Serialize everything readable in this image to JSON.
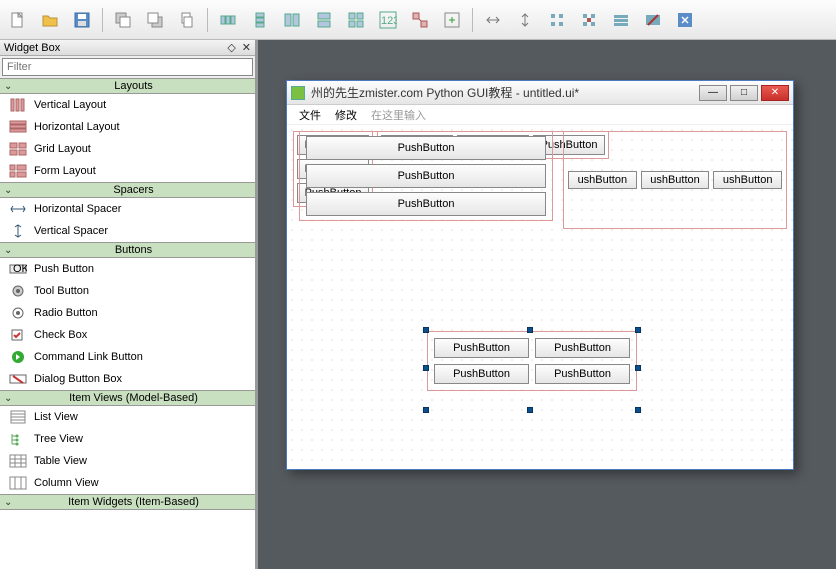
{
  "panel": {
    "title": "Widget Box",
    "filter_placeholder": "Filter"
  },
  "categories": [
    {
      "name": "Layouts",
      "items": [
        {
          "icon": "vlayout",
          "label": "Vertical Layout"
        },
        {
          "icon": "hlayout",
          "label": "Horizontal Layout"
        },
        {
          "icon": "grid",
          "label": "Grid Layout"
        },
        {
          "icon": "form",
          "label": "Form Layout"
        }
      ]
    },
    {
      "name": "Spacers",
      "items": [
        {
          "icon": "hspacer",
          "label": "Horizontal Spacer"
        },
        {
          "icon": "vspacer",
          "label": "Vertical Spacer"
        }
      ]
    },
    {
      "name": "Buttons",
      "items": [
        {
          "icon": "pushbtn",
          "label": "Push Button"
        },
        {
          "icon": "toolbtn",
          "label": "Tool Button"
        },
        {
          "icon": "radio",
          "label": "Radio Button"
        },
        {
          "icon": "check",
          "label": "Check Box"
        },
        {
          "icon": "cmdlink",
          "label": "Command Link Button"
        },
        {
          "icon": "dlgbox",
          "label": "Dialog Button Box"
        }
      ]
    },
    {
      "name": "Item Views (Model-Based)",
      "items": [
        {
          "icon": "list",
          "label": "List View"
        },
        {
          "icon": "treev",
          "label": "Tree View"
        },
        {
          "icon": "table",
          "label": "Table View"
        },
        {
          "icon": "column",
          "label": "Column View"
        }
      ]
    },
    {
      "name": "Item Widgets (Item-Based)",
      "items": []
    }
  ],
  "designed_window": {
    "title": "州的先生zmister.com Python GUI教程 - untitled.ui*",
    "menu": [
      "文件",
      "修改"
    ],
    "menu_hint": "在这里输入",
    "push_label": "PushButton",
    "push_label_trunc": "ushButton"
  },
  "toolbar_icons": [
    "new",
    "open",
    "save",
    "sep",
    "copy",
    "cut",
    "paste",
    "sep",
    "undo",
    "redo",
    "sep",
    "hbox",
    "vbox",
    "hsplit",
    "vsplit",
    "grid",
    "form",
    "break",
    "adjust",
    "sep",
    "spacer1",
    "spacer2",
    "spacer3",
    "spacer4",
    "spacer5",
    "spacer6",
    "spacer7"
  ]
}
